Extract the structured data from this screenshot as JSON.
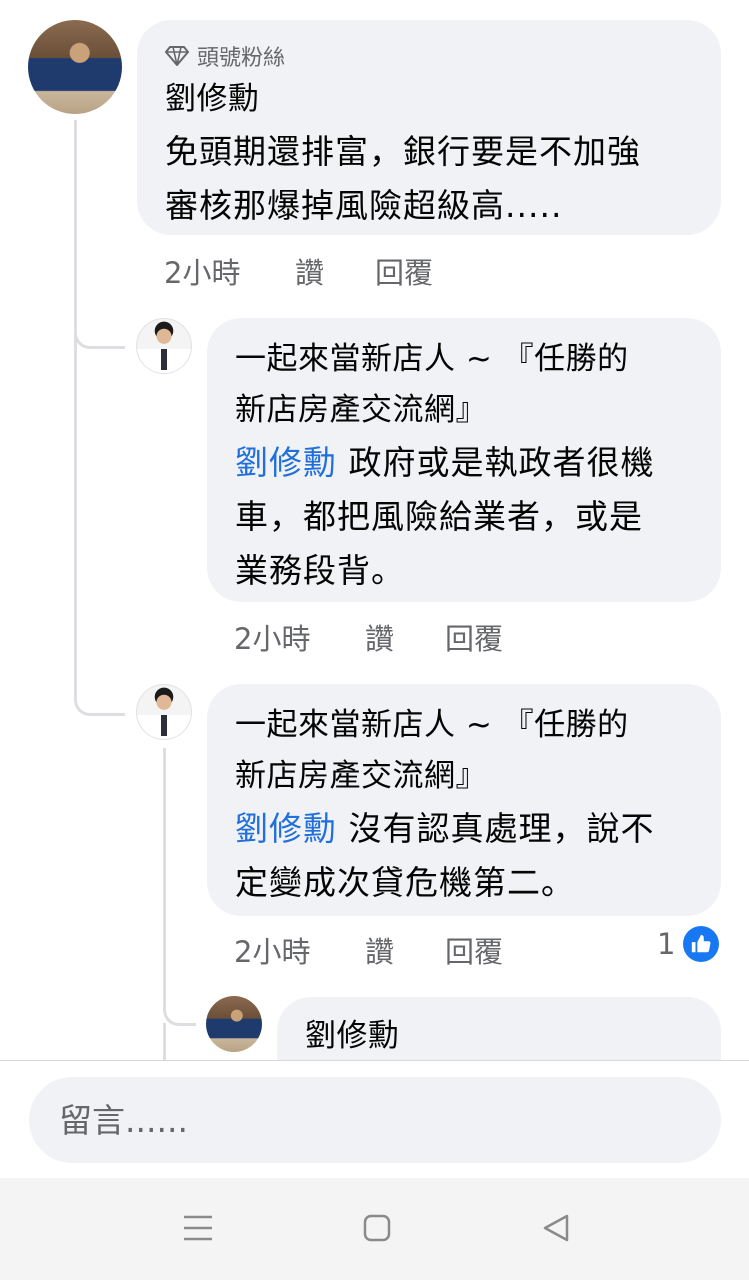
{
  "comments": [
    {
      "badge_icon": "diamond-icon",
      "badge": "頭號粉絲",
      "author": "劉修勳",
      "text_lines": [
        "免頭期還排富，銀行要是不加強",
        "審核那爆掉風險超級高....."
      ],
      "time": "2小時",
      "like": "讚",
      "reply": "回覆"
    },
    {
      "author_lines": [
        "一起來當新店人 ~ 『任勝的",
        "新店房產交流網』"
      ],
      "mention": "劉修勳",
      "text_first": " 政府或是執政者很機",
      "text_lines": [
        "車，都把風險給業者，或是",
        "業務段背。"
      ],
      "time": "2小時",
      "like": "讚",
      "reply": "回覆"
    },
    {
      "author_lines": [
        "一起來當新店人 ~ 『任勝的",
        "新店房產交流網』"
      ],
      "mention": "劉修勳",
      "text_first": " 沒有認真處理，說不",
      "text_lines": [
        "定變成次貸危機第二。"
      ],
      "time": "2小時",
      "like": "讚",
      "reply": "回覆",
      "reaction_count": "1",
      "reaction_icon": "thumbs-up-icon"
    },
    {
      "author": "劉修勳"
    }
  ],
  "composer": {
    "placeholder": "留言......"
  },
  "navbar": {
    "menu_icon": "menu-icon",
    "home_icon": "home-square-icon",
    "back_icon": "back-triangle-icon"
  }
}
